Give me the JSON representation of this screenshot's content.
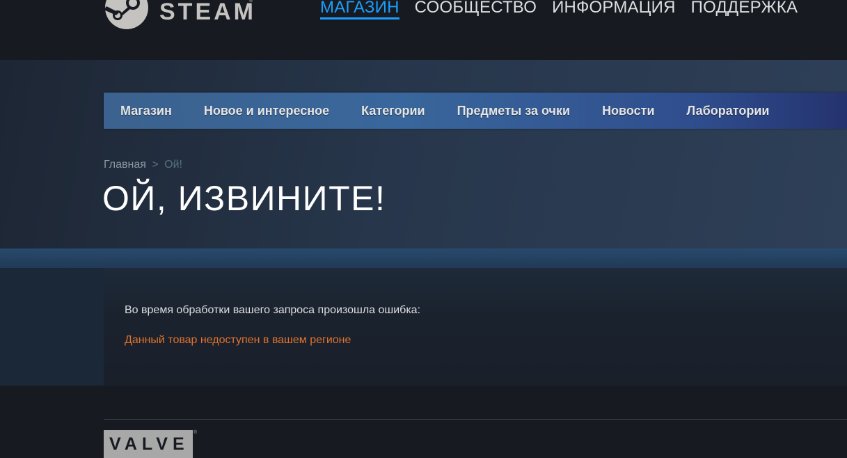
{
  "header": {
    "logo_text": "STEAM",
    "logo_reg": "®",
    "nav": [
      {
        "label": "МАГАЗИН",
        "active": true
      },
      {
        "label": "СООБЩЕСТВО",
        "active": false
      },
      {
        "label": "ИНФОРМАЦИЯ",
        "active": false
      },
      {
        "label": "ПОДДЕРЖКА",
        "active": false
      }
    ]
  },
  "store_nav": {
    "tabs": [
      {
        "label": "Магазин"
      },
      {
        "label": "Новое и интересное"
      },
      {
        "label": "Категории"
      },
      {
        "label": "Предметы за очки"
      },
      {
        "label": "Новости"
      },
      {
        "label": "Лаборатории"
      }
    ]
  },
  "breadcrumb": {
    "home": "Главная",
    "separator": ">",
    "current": "Ой!"
  },
  "page_title": "ОЙ, ИЗВИНИТЕ!",
  "error": {
    "intro": "Во время обработки вашего запроса произошла ошибка:",
    "message": "Данный товар недоступен в вашем регионе"
  },
  "footer": {
    "valve_logo": "VALVE",
    "valve_reg": "®"
  },
  "colors": {
    "accent_blue": "#1a9fff",
    "error_orange": "#e0732d",
    "background": "#171a21"
  }
}
